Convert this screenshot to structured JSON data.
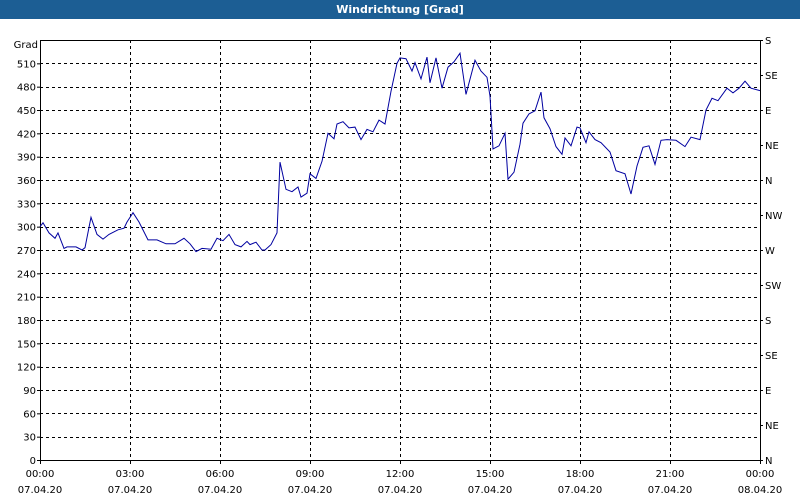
{
  "window": {
    "title": "Windrichtung [Grad]",
    "title_bar_color": "#1c5e94"
  },
  "chart_data": {
    "type": "line",
    "title": "Windrichtung [Grad]",
    "ylabel": "Grad",
    "ylim": [
      0,
      540
    ],
    "yticks": [
      0,
      30,
      60,
      90,
      120,
      150,
      180,
      210,
      240,
      270,
      300,
      330,
      360,
      390,
      420,
      450,
      480,
      510
    ],
    "right_axis_labels": [
      "N",
      "NE",
      "E",
      "SE",
      "S",
      "SW",
      "W",
      "NW",
      "N",
      "NE",
      "E",
      "SE",
      "S"
    ],
    "xlim_hours": [
      0,
      24
    ],
    "x_ticks": [
      {
        "time": "00:00",
        "date": "07.04.20"
      },
      {
        "time": "03:00",
        "date": "07.04.20"
      },
      {
        "time": "06:00",
        "date": "07.04.20"
      },
      {
        "time": "09:00",
        "date": "07.04.20"
      },
      {
        "time": "12:00",
        "date": "07.04.20"
      },
      {
        "time": "15:00",
        "date": "07.04.20"
      },
      {
        "time": "18:00",
        "date": "07.04.20"
      },
      {
        "time": "21:00",
        "date": "07.04.20"
      },
      {
        "time": "00:00",
        "date": "08.04.20"
      }
    ],
    "grid": true,
    "line_color": "#0000a0",
    "series": [
      {
        "x_hours": [
          0,
          0.1,
          0.3,
          0.5,
          0.6,
          0.8,
          0.9,
          1.2,
          1.4,
          1.5,
          1.7,
          1.9,
          2.1,
          2.3,
          2.6,
          2.8,
          2.9,
          3.1,
          3.3,
          3.6,
          3.9,
          4.2,
          4.5,
          4.8,
          5.0,
          5.2,
          5.4,
          5.7,
          5.9,
          6.1,
          6.3,
          6.5,
          6.7,
          6.9,
          7.0,
          7.2,
          7.4,
          7.5,
          7.7,
          7.9,
          8.0,
          8.2,
          8.4,
          8.6,
          8.7,
          8.9,
          9.0,
          9.2,
          9.4,
          9.6,
          9.8,
          9.9,
          10.1,
          10.3,
          10.5,
          10.7,
          10.9,
          11.1,
          11.3,
          11.5,
          11.7,
          11.9,
          12.0,
          12.2,
          12.4,
          12.5,
          12.7,
          12.9,
          13.0,
          13.2,
          13.4,
          13.6,
          13.8,
          14.0,
          14.2,
          14.5,
          14.7,
          14.9,
          15.0,
          15.1,
          15.3,
          15.5,
          15.6,
          15.8,
          16.0,
          16.1,
          16.3,
          16.5,
          16.7,
          16.8,
          17.0,
          17.2,
          17.4,
          17.5,
          17.7,
          17.9,
          18.0,
          18.2,
          18.3,
          18.5,
          18.7,
          19.0,
          19.2,
          19.5,
          19.7,
          19.9,
          20.1,
          20.3,
          20.5,
          20.7,
          20.9,
          21.2,
          21.5,
          21.7,
          22.0,
          22.2,
          22.4,
          22.6,
          22.9,
          23.1,
          23.3,
          23.5,
          23.7,
          24.0
        ],
        "values": [
          300,
          305,
          292,
          285,
          292,
          272,
          274,
          274,
          270,
          273,
          312,
          290,
          284,
          290,
          296,
          298,
          306,
          318,
          306,
          283,
          283,
          278,
          278,
          285,
          278,
          268,
          272,
          271,
          285,
          282,
          290,
          277,
          274,
          281,
          277,
          280,
          270,
          270,
          277,
          292,
          383,
          348,
          345,
          351,
          338,
          343,
          368,
          362,
          384,
          420,
          413,
          432,
          435,
          427,
          428,
          412,
          425,
          422,
          437,
          432,
          474,
          510,
          517,
          516,
          500,
          511,
          490,
          518,
          485,
          517,
          478,
          505,
          512,
          523,
          470,
          514,
          500,
          492,
          468,
          400,
          404,
          420,
          361,
          370,
          406,
          433,
          445,
          449,
          473,
          440,
          426,
          403,
          393,
          414,
          404,
          428,
          427,
          408,
          422,
          412,
          408,
          396,
          372,
          368,
          342,
          378,
          402,
          404,
          380,
          411,
          412,
          411,
          403,
          415,
          412,
          450,
          465,
          462,
          478,
          472,
          478,
          487,
          478,
          475,
          478
        ]
      }
    ]
  }
}
